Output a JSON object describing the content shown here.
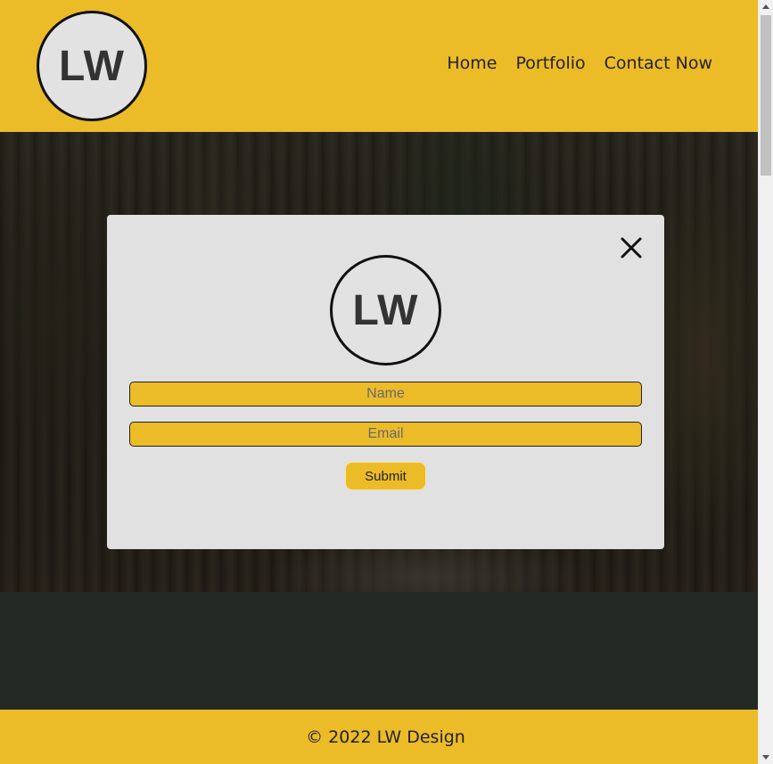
{
  "header": {
    "logo_text": "LW",
    "nav": [
      {
        "label": "Home"
      },
      {
        "label": "Portfolio"
      },
      {
        "label": "Contact Now"
      }
    ]
  },
  "modal": {
    "logo_text": "LW",
    "name_placeholder": "Name",
    "email_placeholder": "Email",
    "submit_label": "Submit",
    "close_icon": "close-icon"
  },
  "footer": {
    "copyright": "© 2022 LW Design"
  },
  "colors": {
    "brand_yellow": "#ecbb28",
    "logo_circle": "#e2e2e2",
    "modal_bg": "#e1e1e1",
    "dark_band": "#232a26",
    "text_dark": "#222222"
  }
}
